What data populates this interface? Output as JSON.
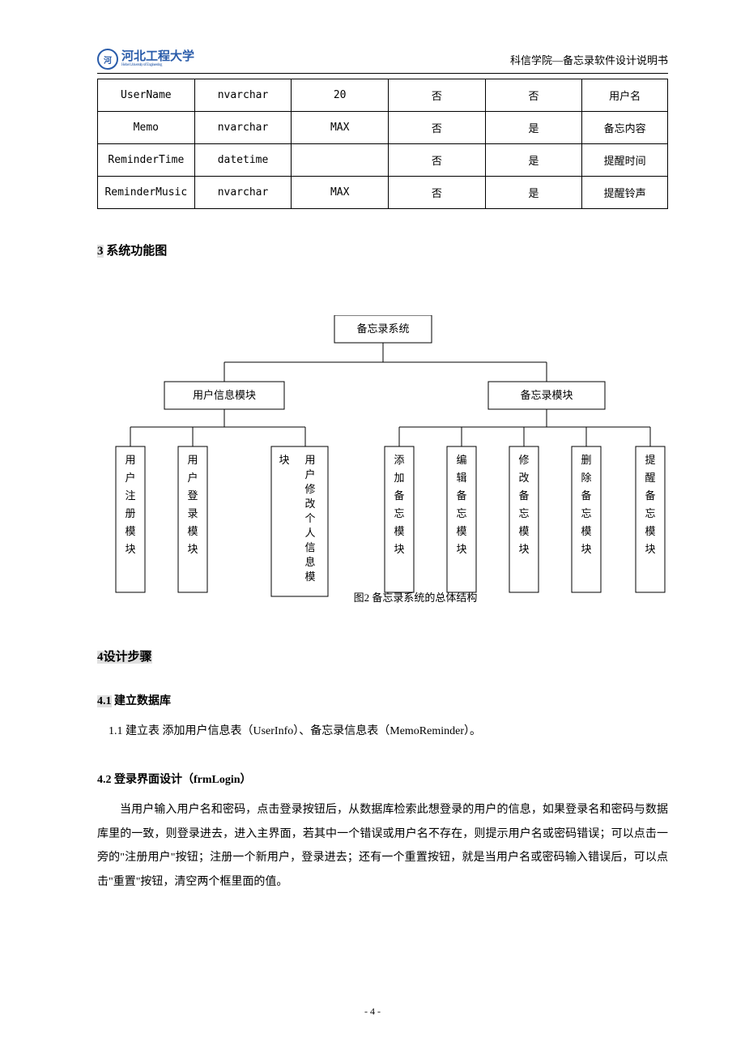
{
  "header": {
    "logo_text": "河北工程大学",
    "logo_sub": "Hebei University of Engineering",
    "right_text": "科信学院—备忘录软件设计说明书"
  },
  "table": {
    "rows": [
      [
        "UserName",
        "nvarchar",
        "20",
        "否",
        "否",
        "用户名"
      ],
      [
        "Memo",
        "nvarchar",
        "MAX",
        "否",
        "是",
        "备忘内容"
      ],
      [
        "ReminderTime",
        "datetime",
        "",
        "否",
        "是",
        "提醒时间"
      ],
      [
        "ReminderMusic",
        "nvarchar",
        "MAX",
        "否",
        "是",
        "提醒铃声"
      ]
    ]
  },
  "section3": {
    "num": "3",
    "title": " 系统功能图"
  },
  "diagram": {
    "root": "备忘录系统",
    "branches": [
      {
        "title": "用户信息模块",
        "leaves": [
          "用户注册模块",
          "用户登录模块",
          "用户修改个人信息模块"
        ],
        "leaf2_prefix": "块"
      },
      {
        "title": "备忘录模块",
        "leaves": [
          "添加备忘模块",
          "编辑备忘模块",
          "修改备忘模块",
          "删除备忘模块",
          "提醒备忘模块"
        ]
      }
    ],
    "caption": "图2 备忘录系统的总体结构"
  },
  "section4": {
    "num": "4",
    "title": "设计步骤"
  },
  "section41": {
    "num": "4.1",
    "title": " 建立数据库",
    "body": "1.1 建立表   添加用户信息表（UserInfo）、备忘录信息表（MemoReminder）。"
  },
  "section42": {
    "num": "4.2",
    "title": " 登录界面设计（frmLogin）",
    "body": "当用户输入用户名和密码，点击登录按钮后，从数据库检索此想登录的用户的信息，如果登录名和密码与数据库里的一致，则登录进去，进入主界面，若其中一个错误或用户名不存在，则提示用户名或密码错误；可以点击一旁的\"注册用户\"按钮；注册一个新用户，登录进去；还有一个重置按钮，就是当用户名或密码输入错误后，可以点击\"重置\"按钮，清空两个框里面的值。"
  },
  "footer": {
    "page": "- 4 -"
  }
}
